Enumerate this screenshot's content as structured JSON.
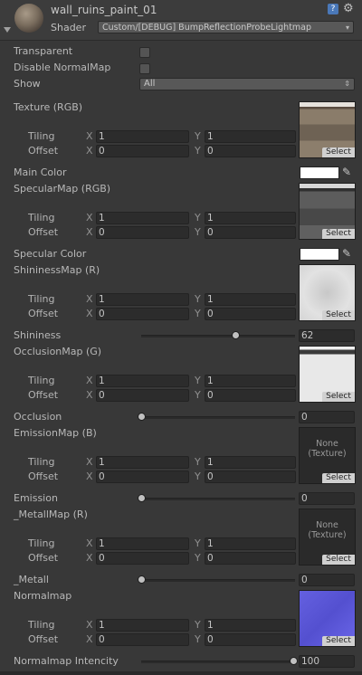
{
  "header": {
    "material_name": "wall_ruins_paint_01",
    "shader_label": "Shader",
    "shader_value": "Custom/[DEBUG] BumpReflectionProbeLightmap"
  },
  "toggles": {
    "transparent": "Transparent",
    "disable_normalmap": "Disable NormalMap",
    "show": "Show",
    "show_value": "All"
  },
  "labels": {
    "tiling": "Tiling",
    "offset": "Offset",
    "x": "X",
    "y": "Y",
    "select": "Select",
    "none_texture_1": "None",
    "none_texture_2": "(Texture)"
  },
  "textures": [
    {
      "label": "Texture (RGB)",
      "tiling_x": "1",
      "tiling_y": "1",
      "offset_x": "0",
      "offset_y": "0",
      "preview": "wall-diffuse"
    },
    {
      "label": "SpecularMap (RGB)",
      "tiling_x": "1",
      "tiling_y": "1",
      "offset_x": "0",
      "offset_y": "0",
      "preview": "wall-specular"
    },
    {
      "label": "ShininessMap (R)",
      "tiling_x": "1",
      "tiling_y": "1",
      "offset_x": "0",
      "offset_y": "0",
      "preview": "light-gray"
    },
    {
      "label": "OcclusionMap (G)",
      "tiling_x": "1",
      "tiling_y": "1",
      "offset_x": "0",
      "offset_y": "0",
      "preview": "white-occlusion"
    },
    {
      "label": "EmissionMap (B)",
      "tiling_x": "1",
      "tiling_y": "1",
      "offset_x": "0",
      "offset_y": "0",
      "preview": "none"
    },
    {
      "label": "_MetallMap (R)",
      "tiling_x": "1",
      "tiling_y": "1",
      "offset_x": "0",
      "offset_y": "0",
      "preview": "none"
    },
    {
      "label": "Normalmap",
      "tiling_x": "1",
      "tiling_y": "1",
      "offset_x": "0",
      "offset_y": "0",
      "preview": "normal-blue"
    }
  ],
  "colors": [
    {
      "label": "Main Color",
      "value": "#ffffff"
    },
    {
      "label": "Specular Color",
      "value": "#ffffff"
    }
  ],
  "sliders": [
    {
      "label": "Shininess",
      "value": "62",
      "fraction": 0.62
    },
    {
      "label": "Occlusion",
      "value": "0",
      "fraction": 0
    },
    {
      "label": "Emission",
      "value": "0",
      "fraction": 0
    },
    {
      "label": "_Metall",
      "value": "0",
      "fraction": 0
    },
    {
      "label": "Normalmap Intencity",
      "value": "100",
      "fraction": 1.0
    }
  ],
  "theme": {
    "background": "#383838",
    "field": "#2c2c2c",
    "normal_map_color": "#5a55d8"
  }
}
